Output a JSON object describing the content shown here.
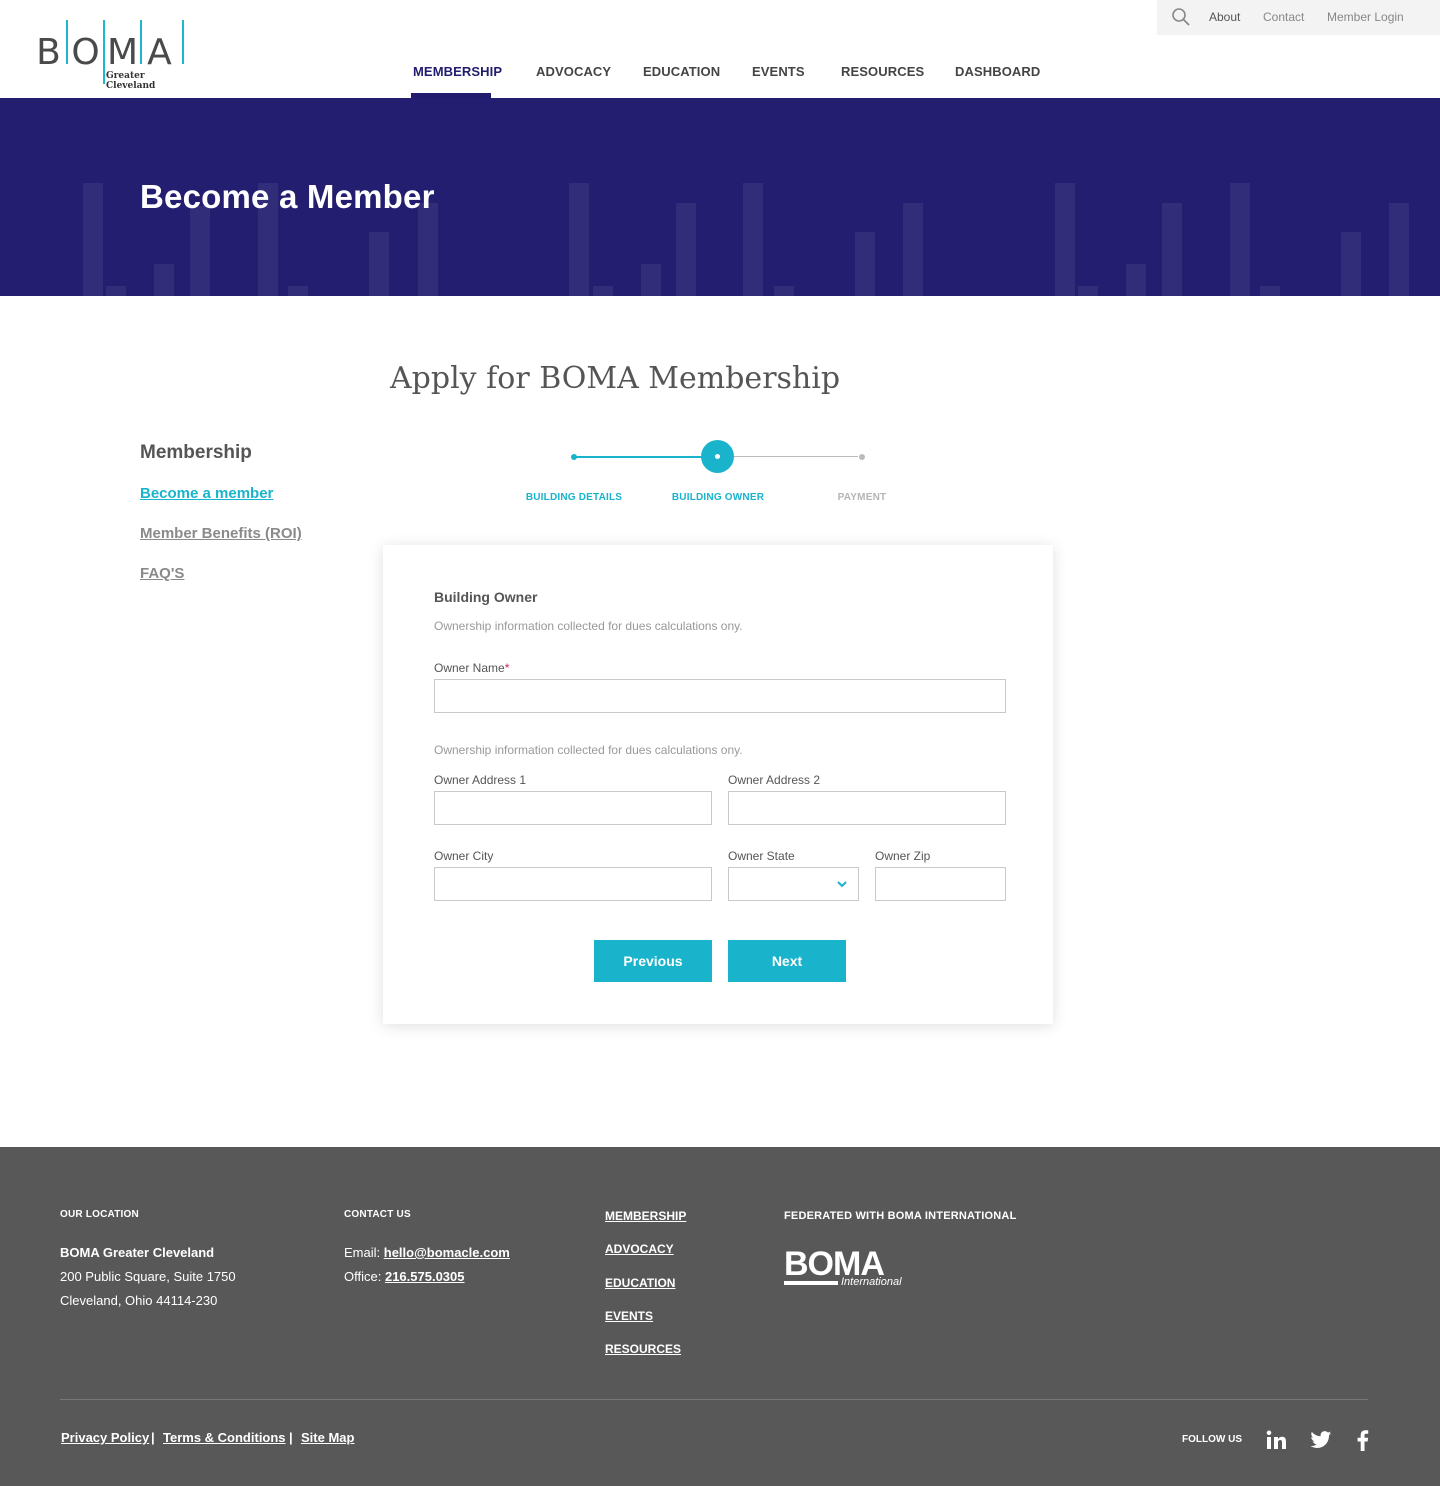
{
  "brand": {
    "logo_letters": [
      "B",
      "O",
      "M",
      "A"
    ],
    "logo_sub": "Greater Cleveland",
    "accent_color": "#19b4cc",
    "navy_color": "#231e6f"
  },
  "utility_nav": {
    "search_icon": "search-icon",
    "items": [
      "About",
      "Contact",
      "Member Login"
    ]
  },
  "main_nav": {
    "items": [
      "MEMBERSHIP",
      "ADVOCACY",
      "EDUCATION",
      "EVENTS",
      "RESOURCES",
      "DASHBOARD"
    ],
    "active": "MEMBERSHIP"
  },
  "hero": {
    "title": "Become a Member"
  },
  "page": {
    "title": "Apply for BOMA Membership"
  },
  "sidebar": {
    "title": "Membership",
    "links": [
      "Become a member",
      "Member Benefits (ROI)",
      "FAQ'S"
    ],
    "active": "Become a member"
  },
  "steps": {
    "labels": [
      "BUILDING DETAILS",
      "BUILDING OWNER",
      "PAYMENT"
    ],
    "current": "BUILDING OWNER"
  },
  "form": {
    "section_title": "Building Owner",
    "note_1": "Ownership information collected for dues calculations ony.",
    "owner_name_label": "Owner Name",
    "required_mark": "*",
    "note_2": "Ownership information collected for dues calculations ony.",
    "address1_label": "Owner Address 1",
    "address2_label": "Owner Address 2",
    "city_label": "Owner City",
    "state_label": "Owner State",
    "zip_label": "Owner Zip",
    "owner_name_value": "",
    "address1_value": "",
    "address2_value": "",
    "city_value": "",
    "state_value": "",
    "zip_value": "",
    "previous_label": "Previous",
    "next_label": "Next"
  },
  "footer": {
    "location_heading": "OUR LOCATION",
    "org_name": "BOMA Greater Cleveland",
    "address_line1": "200 Public Square, Suite 1750",
    "address_line2": "Cleveland, Ohio 44114-230",
    "contact_heading": "CONTACT US",
    "email_label": "Email:",
    "email": "hello@bomacle.com",
    "office_label": "Office:",
    "phone": "216.575.0305",
    "nav": [
      "MEMBERSHIP",
      "ADVOCACY",
      "EDUCATION",
      "EVENTS",
      "RESOURCES"
    ],
    "federated_heading": "FEDERATED WITH BOMA INTERNATIONAL",
    "intl_logo_big": "BOMA",
    "intl_logo_small": "International",
    "legal_links": [
      "Privacy Policy",
      "Terms & Conditions",
      "Site Map"
    ],
    "separator": "|",
    "follow_label": "FOLLOW US",
    "social_icons": [
      "linkedin-icon",
      "twitter-icon",
      "facebook-icon"
    ]
  }
}
